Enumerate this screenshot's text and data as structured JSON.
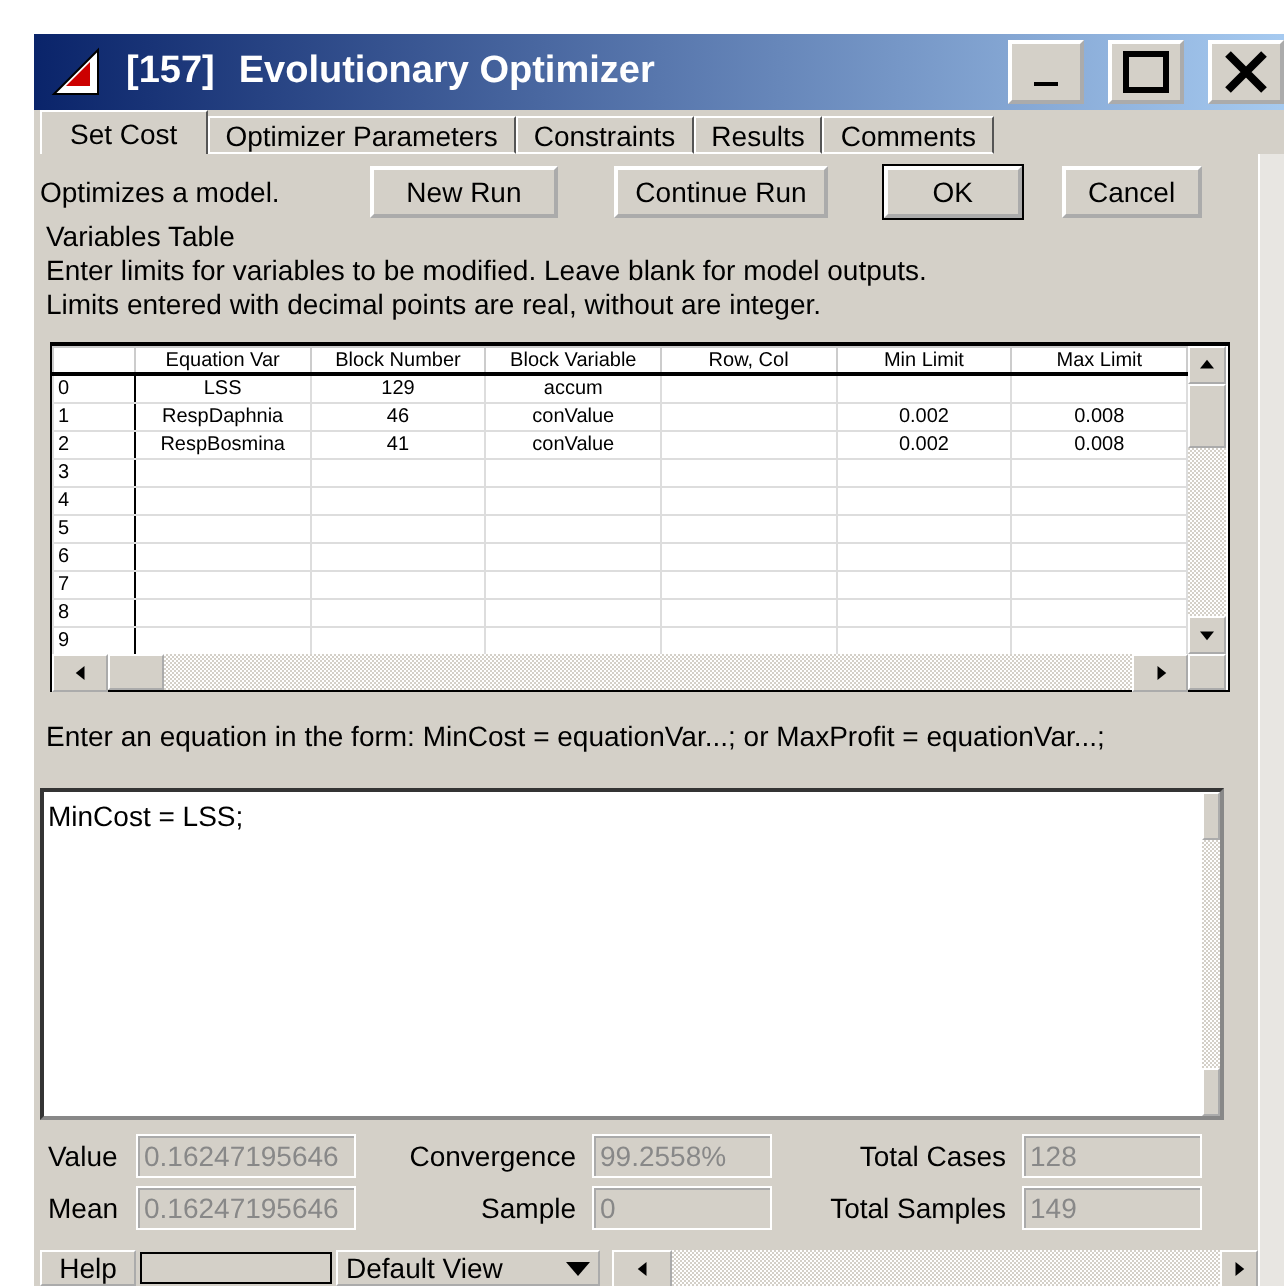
{
  "window": {
    "number": "[157]",
    "title": "Evolutionary Optimizer"
  },
  "tabs": [
    {
      "label": "Set Cost",
      "selected": true
    },
    {
      "label": "Optimizer Parameters",
      "selected": false
    },
    {
      "label": "Constraints",
      "selected": false
    },
    {
      "label": "Results",
      "selected": false
    },
    {
      "label": "Comments",
      "selected": false
    }
  ],
  "description": "Optimizes a model.",
  "buttons": [
    {
      "label": "New Run",
      "default": false
    },
    {
      "label": "Continue Run",
      "default": false
    },
    {
      "label": "OK",
      "default": true
    },
    {
      "label": "Cancel",
      "default": false
    }
  ],
  "instructions": [
    "Variables Table",
    "Enter limits for variables to be modified. Leave blank for model outputs.",
    "Limits entered with decimal points are real, without are integer."
  ],
  "table": {
    "columns": [
      "Equation Var",
      "Block Number",
      "Block Variable",
      "Row, Col",
      "Min Limit",
      "Max Limit"
    ],
    "rows": [
      {
        "index": "0",
        "cells": [
          "LSS",
          "129",
          "accum",
          "",
          "",
          ""
        ]
      },
      {
        "index": "1",
        "cells": [
          "RespDaphnia",
          "46",
          "conValue",
          "",
          "0.002",
          "0.008"
        ]
      },
      {
        "index": "2",
        "cells": [
          "RespBosmina",
          "41",
          "conValue",
          "",
          "0.002",
          "0.008"
        ]
      },
      {
        "index": "3",
        "cells": [
          "",
          "",
          "",
          "",
          "",
          ""
        ]
      },
      {
        "index": "4",
        "cells": [
          "",
          "",
          "",
          "",
          "",
          ""
        ]
      },
      {
        "index": "5",
        "cells": [
          "",
          "",
          "",
          "",
          "",
          ""
        ]
      },
      {
        "index": "6",
        "cells": [
          "",
          "",
          "",
          "",
          "",
          ""
        ]
      },
      {
        "index": "7",
        "cells": [
          "",
          "",
          "",
          "",
          "",
          ""
        ]
      },
      {
        "index": "8",
        "cells": [
          "",
          "",
          "",
          "",
          "",
          ""
        ]
      },
      {
        "index": "9",
        "cells": [
          "",
          "",
          "",
          "",
          "",
          ""
        ]
      }
    ]
  },
  "equation_prompt": "Enter an equation in the form: MinCost = equationVar...; or MaxProfit = equationVar...;",
  "equation": "MinCost = LSS;",
  "stats": [
    {
      "label": "Value",
      "value": "0.16247195646"
    },
    {
      "label": "Convergence",
      "value": "99.2558%"
    },
    {
      "label": "Total Cases",
      "value": "128"
    },
    {
      "label": "Mean",
      "value": "0.16247195646"
    },
    {
      "label": "Sample",
      "value": "0"
    },
    {
      "label": "Total Samples",
      "value": "149"
    }
  ],
  "footer": {
    "help": "Help",
    "view": "Default View"
  }
}
